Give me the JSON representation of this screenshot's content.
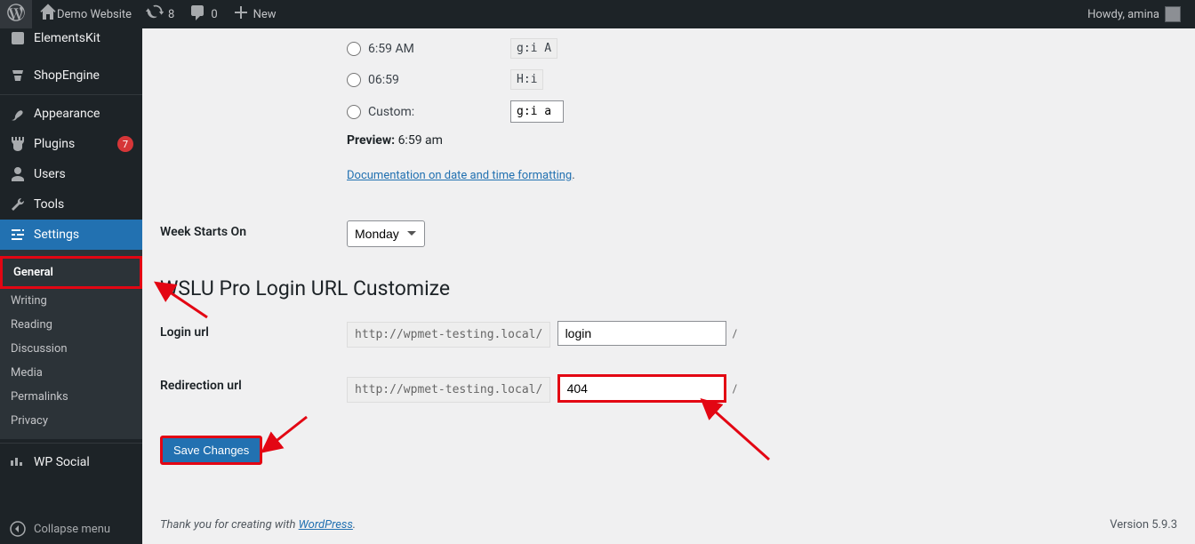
{
  "adminbar": {
    "site_name": "Demo Website",
    "updates_count": "8",
    "comments_count": "0",
    "new_label": "New",
    "howdy": "Howdy, amina"
  },
  "sidebar": {
    "items": [
      {
        "label": "ElementsKit",
        "icon": ""
      },
      {
        "label": "ShopEngine",
        "icon": ""
      },
      {
        "label": "Appearance",
        "icon": ""
      },
      {
        "label": "Plugins",
        "icon": "",
        "badge": "7"
      },
      {
        "label": "Users",
        "icon": ""
      },
      {
        "label": "Tools",
        "icon": ""
      },
      {
        "label": "Settings",
        "icon": ""
      },
      {
        "label": "WP Social",
        "icon": ""
      }
    ],
    "submenu": [
      {
        "label": "General",
        "current": true
      },
      {
        "label": "Writing"
      },
      {
        "label": "Reading"
      },
      {
        "label": "Discussion"
      },
      {
        "label": "Media"
      },
      {
        "label": "Permalinks"
      },
      {
        "label": "Privacy"
      }
    ],
    "collapse_label": "Collapse menu"
  },
  "time_section": {
    "options": [
      {
        "label": "6:59 AM",
        "code": "g:i A"
      },
      {
        "label": "06:59",
        "code": "H:i"
      },
      {
        "label": "Custom:",
        "code": "g:i a",
        "custom": true
      }
    ],
    "preview_label": "Preview:",
    "preview_value": "6:59 am",
    "doc_link": "Documentation on date and time formatting"
  },
  "week": {
    "label": "Week Starts On",
    "value": "Monday"
  },
  "wslu": {
    "heading": "WSLU Pro Login URL Customize",
    "login_label": "Login url",
    "redirect_label": "Redirection url",
    "prefix": "http://wpmet-testing.local/",
    "login_value": "login",
    "redirect_value": "404",
    "suffix": "/"
  },
  "save_label": "Save Changes",
  "footer": {
    "thanks_pre": "Thank you for creating with ",
    "wp": "WordPress",
    "thanks_post": ".",
    "version": "Version 5.9.3"
  }
}
